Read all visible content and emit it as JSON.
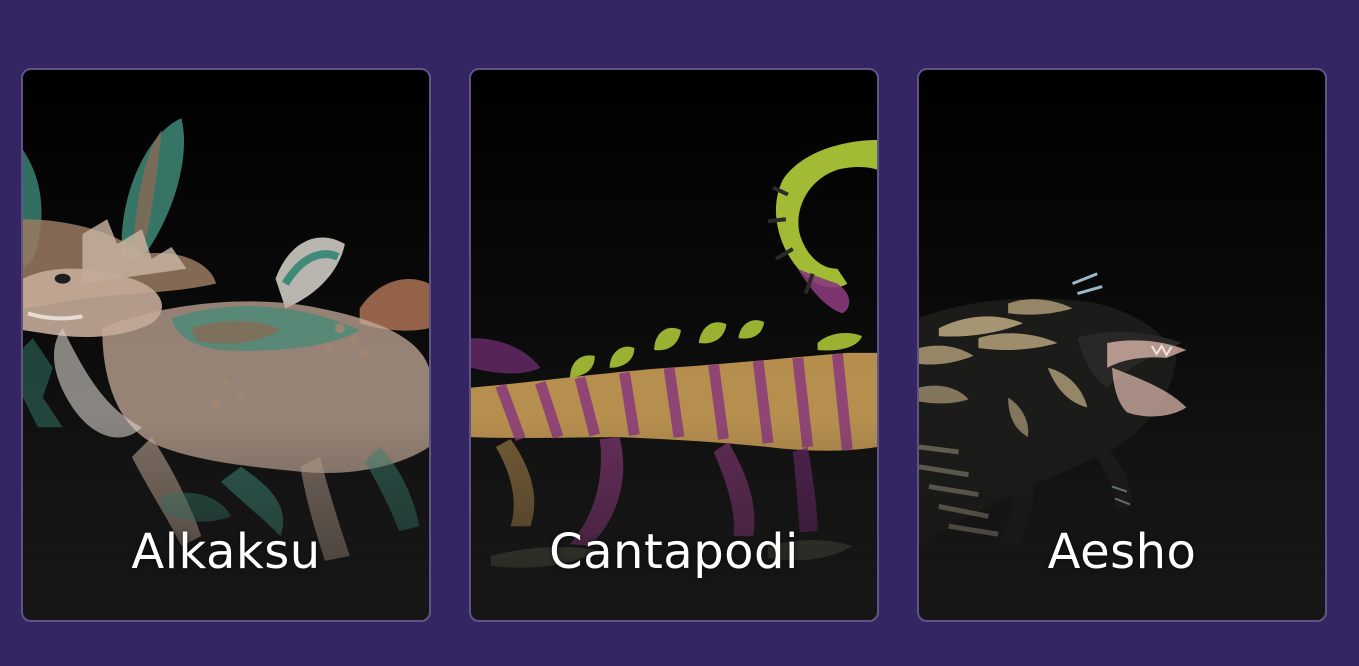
{
  "colors": {
    "page_background": "#352563",
    "card_border": "#5e5585",
    "card_background_top": "#000000",
    "card_background_bottom": "#1d1d1d",
    "label_text": "#ffffff"
  },
  "cards": [
    {
      "name": "Alkaksu"
    },
    {
      "name": "Cantapodi"
    },
    {
      "name": "Aesho"
    }
  ]
}
